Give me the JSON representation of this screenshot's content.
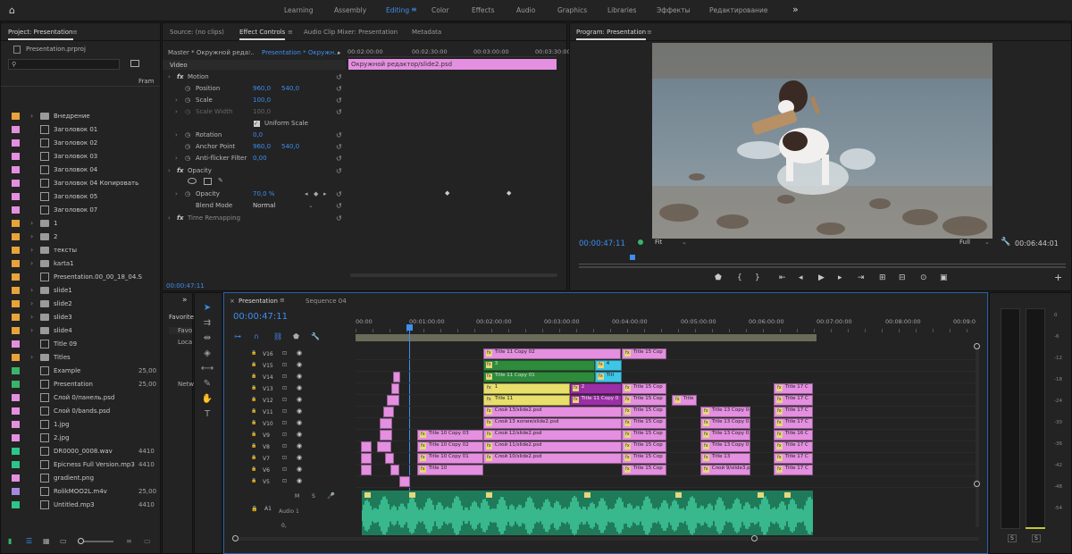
{
  "topbar": {
    "workspaces": [
      "Learning",
      "Assembly",
      "Editing",
      "Color",
      "Effects",
      "Audio",
      "Graphics",
      "Libraries",
      "Эффекты",
      "Редактирование"
    ],
    "active": "Editing",
    "more": "»"
  },
  "project": {
    "title": "Project: Presentation",
    "file": "Presentation.prproj",
    "col_frame": "Fram",
    "items": [
      {
        "name": "Внедрение",
        "color": "#e8a33a",
        "type": "folder",
        "exp": true,
        "fr": ""
      },
      {
        "name": "Заголовок 01",
        "color": "#e48fe0",
        "type": "clip",
        "exp": false,
        "fr": ""
      },
      {
        "name": "Заголовок 02",
        "color": "#e48fe0",
        "type": "clip",
        "exp": false,
        "fr": ""
      },
      {
        "name": "Заголовок 03",
        "color": "#e48fe0",
        "type": "clip",
        "exp": false,
        "fr": ""
      },
      {
        "name": "Заголовок 04",
        "color": "#e48fe0",
        "type": "clip",
        "exp": false,
        "fr": ""
      },
      {
        "name": "Заголовок 04 Копировать",
        "color": "#e48fe0",
        "type": "clip",
        "exp": false,
        "fr": ""
      },
      {
        "name": "Заголовок 05",
        "color": "#e48fe0",
        "type": "clip",
        "exp": false,
        "fr": ""
      },
      {
        "name": "Заголовок 07",
        "color": "#e48fe0",
        "type": "clip",
        "exp": false,
        "fr": ""
      },
      {
        "name": "1",
        "color": "#e8a33a",
        "type": "folder",
        "exp": true,
        "fr": ""
      },
      {
        "name": "2",
        "color": "#e8a33a",
        "type": "folder",
        "exp": true,
        "fr": ""
      },
      {
        "name": "тексты",
        "color": "#e8a33a",
        "type": "folder",
        "exp": true,
        "fr": ""
      },
      {
        "name": "karta1",
        "color": "#e8a33a",
        "type": "folder",
        "exp": true,
        "fr": ""
      },
      {
        "name": "Presentation.00_00_18_04.S",
        "color": "#e8a33a",
        "type": "clip",
        "exp": false,
        "fr": ""
      },
      {
        "name": "slide1",
        "color": "#e8a33a",
        "type": "folder",
        "exp": true,
        "fr": ""
      },
      {
        "name": "slide2",
        "color": "#e8a33a",
        "type": "folder",
        "exp": true,
        "fr": ""
      },
      {
        "name": "slide3",
        "color": "#e8a33a",
        "type": "folder",
        "exp": true,
        "fr": ""
      },
      {
        "name": "slide4",
        "color": "#e8a33a",
        "type": "folder",
        "exp": true,
        "fr": ""
      },
      {
        "name": "Title 09",
        "color": "#e48fe0",
        "type": "clip",
        "exp": false,
        "fr": ""
      },
      {
        "name": "Titles",
        "color": "#e8a33a",
        "type": "folder",
        "exp": true,
        "fr": ""
      },
      {
        "name": "Example",
        "color": "#3bb36a",
        "type": "seq",
        "exp": false,
        "fr": "25,00"
      },
      {
        "name": "Presentation",
        "color": "#3bb36a",
        "type": "seq",
        "exp": false,
        "fr": "25,00"
      },
      {
        "name": "Слой 0/панель.psd",
        "color": "#e48fe0",
        "type": "clip",
        "exp": false,
        "fr": ""
      },
      {
        "name": "Слой 0/bands.psd",
        "color": "#e48fe0",
        "type": "clip",
        "exp": false,
        "fr": ""
      },
      {
        "name": "1.jpg",
        "color": "#e48fe0",
        "type": "clip",
        "exp": false,
        "fr": ""
      },
      {
        "name": "2.jpg",
        "color": "#e48fe0",
        "type": "clip",
        "exp": false,
        "fr": ""
      },
      {
        "name": "DR0000_0008.wav",
        "color": "#2ec48a",
        "type": "audio",
        "exp": false,
        "fr": "4410"
      },
      {
        "name": "Epicness Full Version.mp3",
        "color": "#2ec48a",
        "type": "audio",
        "exp": false,
        "fr": "4410"
      },
      {
        "name": "gradient.png",
        "color": "#e48fe0",
        "type": "clip",
        "exp": false,
        "fr": ""
      },
      {
        "name": "RolikMOO2L.m4v",
        "color": "#a688e0",
        "type": "clip",
        "exp": false,
        "fr": "25,00"
      },
      {
        "name": "Untitled.mp3",
        "color": "#2ec48a",
        "type": "audio",
        "exp": false,
        "fr": "4410"
      }
    ]
  },
  "effect_controls": {
    "tabs": [
      "Source: (no clips)",
      "Effect Controls",
      "Audio Clip Mixer: Presentation",
      "Metadata"
    ],
    "active": "Effect Controls",
    "master": "Master * Окружной реда...",
    "clip": "Presentation * Окружн...",
    "times": [
      "00:02:00:00",
      "00:02:30:00",
      "00:03:00:00",
      "00:03:30:00"
    ],
    "clip_bar": "Окружной редактор/slide2.psd",
    "video": "Video",
    "motion": "Motion",
    "position_label": "Position",
    "position_x": "960,0",
    "position_y": "540,0",
    "scale_label": "Scale",
    "scale_val": "100,0",
    "scale_width_label": "Scale Width",
    "scale_width_val": "100,0",
    "uniform_label": "Uniform Scale",
    "rotation_label": "Rotation",
    "rotation_val": "0,0",
    "anchor_label": "Anchor Point",
    "anchor_x": "960,0",
    "anchor_y": "540,0",
    "antiflicker_label": "Anti-flicker Filter",
    "antiflicker_val": "0,00",
    "opacity_section": "Opacity",
    "opacity_label": "Opacity",
    "opacity_val": "70,0 %",
    "blend_label": "Blend Mode",
    "blend_val": "Normal",
    "time_remap": "Time Remapping",
    "timecode": "00:00:47:11"
  },
  "program": {
    "title": "Program: Presentation",
    "timecode": "00:00:47:11",
    "fit": "Fit",
    "quality": "Full",
    "duration": "00:06:44:01"
  },
  "effects_panel": {
    "items": [
      "Favorite",
      "Favo",
      "Loca",
      "Netw"
    ]
  },
  "timeline": {
    "tabs": [
      "Presentation",
      "Sequence 04"
    ],
    "active": "Presentation",
    "timecode": "00:00:47:11",
    "ruler": [
      "00:00",
      "00:01:00:00",
      "00:02:00:00",
      "00:03:00:00",
      "00:04:00:00",
      "00:05:00:00",
      "00:06:00:00",
      "00:07:00:00",
      "00:08:00:00",
      "00:09:0"
    ],
    "tracks": [
      "V16",
      "V15",
      "V14",
      "V13",
      "V12",
      "V11",
      "V10",
      "V9",
      "V8",
      "V7",
      "V6",
      "V5"
    ],
    "audio_track": "A1",
    "audio_label": "Audio 1",
    "audio_vol": "0,",
    "clips": [
      {
        "label": "Title 11 Copy 02",
        "color": "pink",
        "track": 0,
        "start": 541,
        "end": 695,
        "fx": true
      },
      {
        "label": "Title 15 Cop",
        "color": "pink",
        "track": 0,
        "start": 696,
        "end": 746,
        "fx": true
      },
      {
        "label": "3",
        "color": "green",
        "track": 1,
        "start": 541,
        "end": 666,
        "fx": true
      },
      {
        "label": "4",
        "color": "cyan",
        "track": 1,
        "start": 666,
        "end": 696,
        "fx": true
      },
      {
        "label": "Title 11 Copy 01",
        "color": "green",
        "track": 2,
        "start": 541,
        "end": 666,
        "fx": true
      },
      {
        "label": "Titl",
        "color": "cyan",
        "track": 2,
        "start": 666,
        "end": 696,
        "fx": true
      },
      {
        "label": "1",
        "color": "yellow",
        "track": 3,
        "start": 541,
        "end": 638,
        "fx": true
      },
      {
        "label": "2",
        "color": "purple",
        "track": 3,
        "start": 638,
        "end": 696,
        "fx": true
      },
      {
        "label": "Title 15 Cop",
        "color": "pink",
        "track": 3,
        "start": 696,
        "end": 746,
        "fx": true
      },
      {
        "label": "Title 17 C",
        "color": "pink",
        "track": 3,
        "start": 866,
        "end": 910,
        "fx": true
      },
      {
        "label": "Title 11",
        "color": "yellow",
        "track": 4,
        "start": 541,
        "end": 638,
        "fx": true
      },
      {
        "label": "Title 11 Copy 0",
        "color": "purple",
        "track": 4,
        "start": 638,
        "end": 696,
        "fx": true
      },
      {
        "label": "Title 15 Cop",
        "color": "pink",
        "track": 4,
        "start": 696,
        "end": 746,
        "fx": true
      },
      {
        "label": "Title",
        "color": "pink",
        "track": 4,
        "start": 752,
        "end": 780,
        "fx": true
      },
      {
        "label": "Title 17 C",
        "color": "pink",
        "track": 4,
        "start": 866,
        "end": 910,
        "fx": true
      },
      {
        "label": "Слой 13/slide2.psd",
        "color": "pink",
        "track": 5,
        "start": 541,
        "end": 696,
        "fx": true
      },
      {
        "label": "Title 15 Cop",
        "color": "pink",
        "track": 5,
        "start": 696,
        "end": 746,
        "fx": true
      },
      {
        "label": "Title 13 Copy 04",
        "color": "pink",
        "track": 5,
        "start": 784,
        "end": 840,
        "fx": true
      },
      {
        "label": "Title 17 C",
        "color": "pink",
        "track": 5,
        "start": 866,
        "end": 910,
        "fx": true
      },
      {
        "label": "Слой 13 копия/slide2.psd",
        "color": "pink",
        "track": 6,
        "start": 541,
        "end": 696,
        "fx": true
      },
      {
        "label": "Title 15 Cop",
        "color": "pink",
        "track": 6,
        "start": 696,
        "end": 746,
        "fx": true
      },
      {
        "label": "Title 13 Copy 03",
        "color": "pink",
        "track": 6,
        "start": 784,
        "end": 840,
        "fx": true
      },
      {
        "label": "Title 17 C",
        "color": "pink",
        "track": 6,
        "start": 866,
        "end": 910,
        "fx": true
      },
      {
        "label": "Title 10 Copy 03",
        "color": "pink",
        "track": 7,
        "start": 467,
        "end": 541,
        "fx": true
      },
      {
        "label": "Слой 12/slide2.psd",
        "color": "pink",
        "track": 7,
        "start": 541,
        "end": 696,
        "fx": true
      },
      {
        "label": "Title 15 Cop",
        "color": "pink",
        "track": 7,
        "start": 696,
        "end": 746,
        "fx": true
      },
      {
        "label": "Title 13 Copy 02",
        "color": "pink",
        "track": 7,
        "start": 784,
        "end": 840,
        "fx": true
      },
      {
        "label": "Title 16 C",
        "color": "pink",
        "track": 7,
        "start": 866,
        "end": 910,
        "fx": true
      },
      {
        "label": "Title 10 Copy 02",
        "color": "pink",
        "track": 8,
        "start": 467,
        "end": 541,
        "fx": true
      },
      {
        "label": "Слой 11/slide2.psd",
        "color": "pink",
        "track": 8,
        "start": 541,
        "end": 696,
        "fx": true
      },
      {
        "label": "Title 15 Cop",
        "color": "pink",
        "track": 8,
        "start": 696,
        "end": 746,
        "fx": true
      },
      {
        "label": "Title 13 Copy 01",
        "color": "pink",
        "track": 8,
        "start": 784,
        "end": 840,
        "fx": true
      },
      {
        "label": "Title 17 C",
        "color": "pink",
        "track": 8,
        "start": 866,
        "end": 910,
        "fx": true
      },
      {
        "label": "Title 10 Copy 01",
        "color": "pink",
        "track": 9,
        "start": 467,
        "end": 541,
        "fx": true
      },
      {
        "label": "Слой 10/slide2.psd",
        "color": "pink",
        "track": 9,
        "start": 541,
        "end": 696,
        "fx": true
      },
      {
        "label": "Title 15 Cop",
        "color": "pink",
        "track": 9,
        "start": 696,
        "end": 746,
        "fx": true
      },
      {
        "label": "Title 13",
        "color": "pink",
        "track": 9,
        "start": 784,
        "end": 840,
        "fx": true
      },
      {
        "label": "Title 17 C",
        "color": "pink",
        "track": 9,
        "start": 866,
        "end": 910,
        "fx": true
      },
      {
        "label": "Title 10",
        "color": "pink",
        "track": 10,
        "start": 467,
        "end": 541,
        "fx": true
      },
      {
        "label": "Title 15 Cop",
        "color": "pink",
        "track": 10,
        "start": 696,
        "end": 746,
        "fx": true
      },
      {
        "label": "Слой 9/slide3.p",
        "color": "pink",
        "track": 10,
        "start": 784,
        "end": 840,
        "fx": true
      },
      {
        "label": "Title 17 C",
        "color": "pink",
        "track": 10,
        "start": 866,
        "end": 910,
        "fx": true
      }
    ]
  },
  "meter": {
    "db": [
      "0",
      "-6",
      "-12",
      "-18",
      "-24",
      "-30",
      "-36",
      "-42",
      "-48",
      "-54"
    ],
    "solo": [
      "S",
      "S"
    ]
  }
}
